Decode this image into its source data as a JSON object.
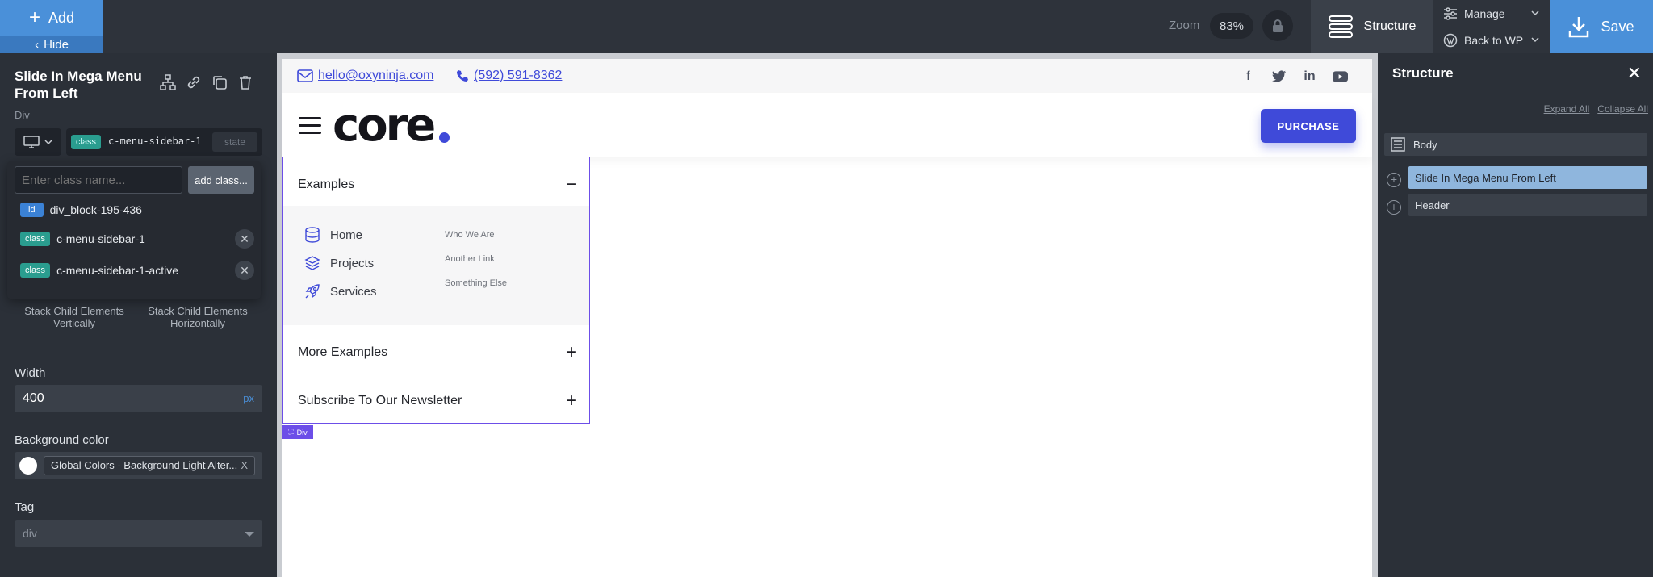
{
  "topbar": {
    "add_label": "Add",
    "hide_label": "Hide",
    "zoom_label": "Zoom",
    "zoom_value": "83%",
    "structure_label": "Structure",
    "manage_label": "Manage",
    "back_label": "Back to WP",
    "save_label": "Save"
  },
  "left_panel": {
    "element_title": "Slide In Mega Menu From Left",
    "element_type": "Div",
    "class_badge": "class",
    "current_class": "c-menu-sidebar-1",
    "state_label": "state",
    "dropdown": {
      "input_placeholder": "Enter class name...",
      "add_button": "add class...",
      "items": [
        {
          "badge": "id",
          "name": "div_block-195-436"
        },
        {
          "badge": "class",
          "name": "c-menu-sidebar-1"
        },
        {
          "badge": "class",
          "name": "c-menu-sidebar-1-active"
        }
      ]
    },
    "stack_vertical": "Stack Child Elements Vertically",
    "stack_horizontal": "Stack Child Elements Horizontally",
    "width_label": "Width",
    "width_value": "400",
    "width_unit": "px",
    "bg_label": "Background color",
    "bg_value": "Global Colors - Background Light Alter...",
    "bg_clear": "X",
    "tag_label": "Tag",
    "tag_value": "div"
  },
  "canvas": {
    "email": "hello@oxyninja.com",
    "phone": "(592) 591-8362",
    "logo_text": "core",
    "purchase_label": "PURCHASE",
    "accordion": [
      {
        "title": "Examples",
        "symbol": "−"
      },
      {
        "title": "More Examples",
        "symbol": "+"
      },
      {
        "title": "Subscribe To Our Newsletter",
        "symbol": "+"
      }
    ],
    "menu_links": [
      "Home",
      "Projects",
      "Services"
    ],
    "sub_links": [
      "Who We Are",
      "Another Link",
      "Something Else"
    ],
    "selected_tag": "Div"
  },
  "right_panel": {
    "title": "Structure",
    "expand_all": "Expand All",
    "collapse_all": "Collapse All",
    "tree": [
      "Body",
      "Slide In Mega Menu From Left",
      "Header"
    ]
  },
  "colors": {
    "accent_blue": "#4a90d9",
    "brand_indigo": "#3f4ad9",
    "selection_purple": "#6c4ee8",
    "tree_selected": "#8fb6dd"
  }
}
